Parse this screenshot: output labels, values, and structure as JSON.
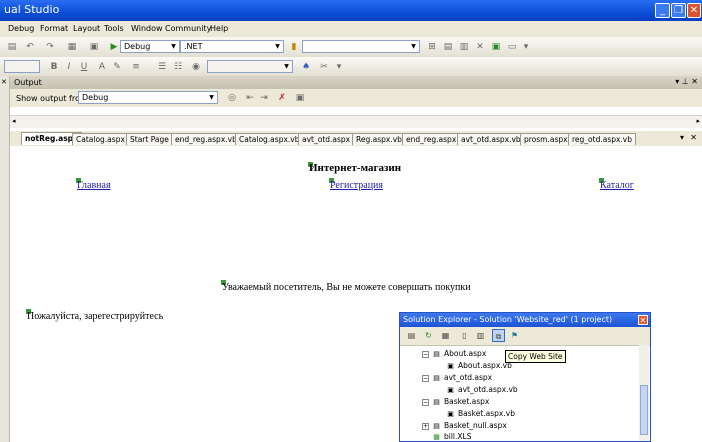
{
  "window": {
    "title": "ual Studio",
    "min": "_",
    "restore": "❐",
    "close": "✕"
  },
  "menu": [
    "Debug",
    "Format",
    "Layout",
    "Tools",
    "Window",
    "Community",
    "Help"
  ],
  "toolbar1": {
    "config": "Debug",
    "platform": ".NET"
  },
  "output": {
    "title": "Output",
    "show_from_label": "Show output from:",
    "show_from_value": "Debug",
    "pin": "▾ ⊥ ✕"
  },
  "tabs": [
    "notReg.aspx",
    "Catalog.aspx",
    "Start Page",
    "end_reg.aspx.vb",
    "Catalog.aspx.vb",
    "avt_otd.aspx",
    "Reg.aspx.vb",
    "end_reg.aspx",
    "avt_otd.aspx.vb",
    "prosm.aspx",
    "reg_otd.aspx.vb"
  ],
  "page": {
    "heading": "Интернет-магазин",
    "nav": {
      "home": "Главная",
      "register": "Регистрация",
      "catalog": "Каталог"
    },
    "message": "Уважаемый посетитель, Вы не можете совершать покупки",
    "prompt": "Пожалуйста, зарегестрируйтесь"
  },
  "solution_explorer": {
    "title": "Solution Explorer - Solution 'Website_red' (1 project)",
    "tooltip": "Copy Web Site",
    "items": [
      {
        "label": "About.aspx",
        "level": 0
      },
      {
        "label": "About.aspx.vb",
        "level": 1
      },
      {
        "label": "avt_otd.aspx",
        "level": 0
      },
      {
        "label": "avt_otd.aspx.vb",
        "level": 1
      },
      {
        "label": "Basket.aspx",
        "level": 0
      },
      {
        "label": "Basket.aspx.vb",
        "level": 1
      },
      {
        "label": "Basket_null.aspx",
        "level": 0
      },
      {
        "label": "bill.XLS",
        "level": 0
      }
    ]
  },
  "colors": {
    "titlebar": "#0a4fd6",
    "chrome": "#ece9d8",
    "link": "#1f1fa8"
  }
}
